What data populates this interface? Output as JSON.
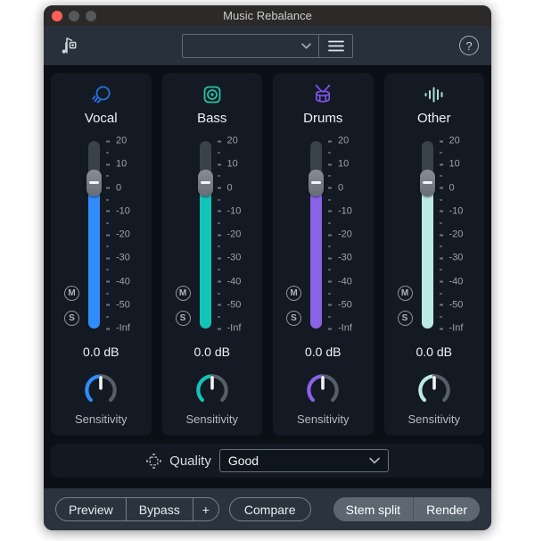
{
  "titlebar": {
    "title": "Music Rebalance"
  },
  "toolbar": {
    "preset_value": "",
    "help_label": "?",
    "icons": [
      "music-rebalance-logo-icon",
      "chevron-down-icon",
      "hamburger-menu-icon",
      "help-icon"
    ]
  },
  "mixer": {
    "ticks": [
      "20",
      "10",
      "0",
      "-10",
      "-20",
      "-30",
      "-40",
      "-50",
      "-Inf"
    ],
    "fader_position_db": 0,
    "strips": [
      {
        "id": "vocal",
        "label": "Vocal",
        "icon": "vocal-head-icon",
        "color": "#2f8cfb",
        "icon_color": "#2273e0",
        "value_db": "0.0 dB",
        "mute_label": "M",
        "solo_label": "S",
        "knob_label": "Sensitivity"
      },
      {
        "id": "bass",
        "label": "Bass",
        "icon": "bass-speaker-icon",
        "color": "#14c4b8",
        "icon_color": "#23c1a6",
        "value_db": "0.0 dB",
        "mute_label": "M",
        "solo_label": "S",
        "knob_label": "Sensitivity"
      },
      {
        "id": "drums",
        "label": "Drums",
        "icon": "drums-icon",
        "color": "#8a63e8",
        "icon_color": "#7b54e6",
        "value_db": "0.0 dB",
        "mute_label": "M",
        "solo_label": "S",
        "knob_label": "Sensitivity"
      },
      {
        "id": "other",
        "label": "Other",
        "icon": "waveform-bars-icon",
        "color": "#bde9e3",
        "icon_color": "#a7ded8",
        "value_db": "0.0 dB",
        "mute_label": "M",
        "solo_label": "S",
        "knob_label": "Sensitivity"
      }
    ]
  },
  "quality": {
    "label": "Quality",
    "value": "Good",
    "icon": "chip-icon"
  },
  "footer": {
    "preview": "Preview",
    "bypass": "Bypass",
    "add": "+",
    "compare": "Compare",
    "stem_split": "Stem split",
    "render": "Render"
  }
}
